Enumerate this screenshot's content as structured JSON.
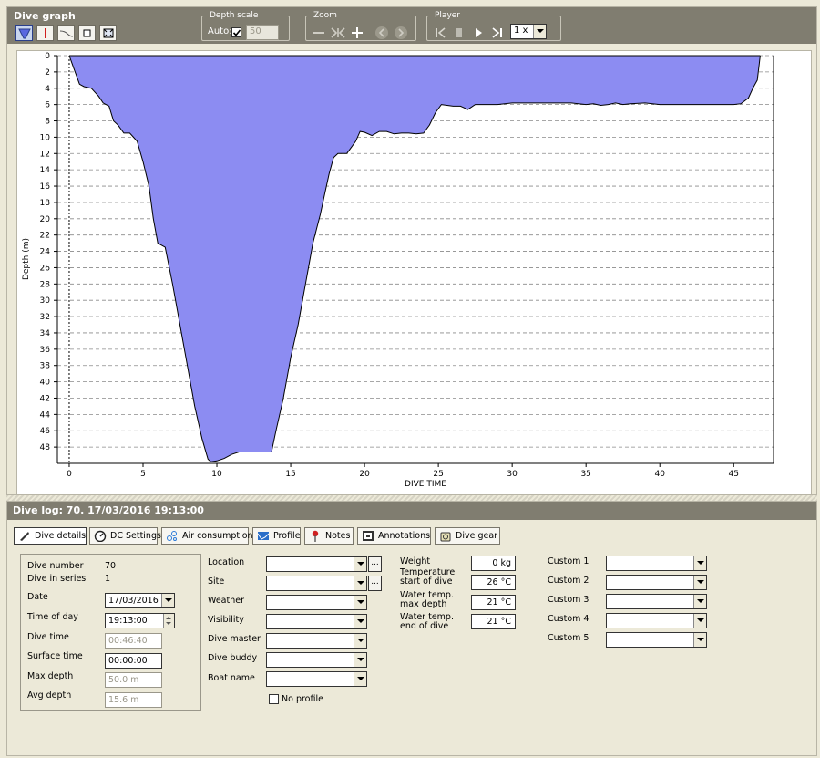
{
  "graph": {
    "title": "Dive graph",
    "groups": {
      "depth_scale": {
        "label": "Depth scale",
        "auto_label": "Auto:",
        "auto_checked": true,
        "value": "50"
      },
      "zoom": {
        "label": "Zoom"
      },
      "player": {
        "label": "Player",
        "speed": "1 x"
      }
    },
    "tools": [
      {
        "name": "profile-tool",
        "icon": "funnel-icon",
        "active": true
      },
      {
        "name": "marker-tool",
        "icon": "marker-icon",
        "active": false
      },
      {
        "name": "curve-tool",
        "icon": "curve-icon",
        "active": false
      },
      {
        "name": "single-view-tool",
        "icon": "square-icon",
        "active": false
      },
      {
        "name": "full-view-tool",
        "icon": "expand-icon",
        "active": false
      }
    ]
  },
  "chart_data": {
    "type": "area",
    "xlabel": "DIVE TIME",
    "ylabel": "Depth (m)",
    "xlim": [
      -0.8,
      47.7
    ],
    "ylim": [
      50,
      0
    ],
    "x_ticks": [
      0,
      5,
      10,
      15,
      20,
      25,
      30,
      35,
      40,
      45
    ],
    "y_ticks": [
      0,
      2,
      4,
      6,
      8,
      10,
      12,
      14,
      16,
      18,
      20,
      22,
      24,
      26,
      28,
      30,
      32,
      34,
      36,
      38,
      40,
      42,
      44,
      46,
      48
    ],
    "grid": "horizontal-dashed",
    "fill_color": "#8c8cf2",
    "line_color": "#000000",
    "series": [
      {
        "x": [
          0,
          0.3,
          0.7,
          1,
          1.5,
          2,
          2.3,
          2.7,
          3,
          3.3,
          3.7,
          4.1,
          4.3,
          4.6,
          5,
          5.4,
          5.7,
          6,
          6.5,
          7,
          7.5,
          8,
          8.5,
          9,
          9.4,
          9.6,
          10,
          10.5,
          11,
          11.5,
          13.7,
          14,
          14.5,
          15,
          15.5,
          16,
          16.5,
          17,
          17.3,
          17.6,
          17.9,
          18.2,
          18.8,
          19,
          19.4,
          19.7,
          20,
          20.5,
          21,
          21.5,
          22,
          22.5,
          23,
          23.5,
          24,
          24.4,
          24.8,
          25.2,
          26,
          26.5,
          27,
          27.5,
          28,
          29,
          30,
          31,
          32,
          33,
          34,
          35,
          35.5,
          36,
          36.5,
          37,
          37.5,
          38,
          39,
          40,
          41,
          42,
          43,
          44,
          45,
          45.5,
          46,
          46.3,
          46.6,
          46.8
        ],
        "y": [
          0,
          1.5,
          3.5,
          3.8,
          4,
          5,
          5.8,
          6.2,
          8,
          8.5,
          9.5,
          9.5,
          9.9,
          10.5,
          13,
          16,
          20,
          23,
          23.5,
          28,
          33,
          38,
          43,
          47,
          49.5,
          49.8,
          49.7,
          49.4,
          48.9,
          48.6,
          48.6,
          46,
          42,
          37,
          33,
          28,
          23,
          19.5,
          17,
          14.5,
          12.5,
          12,
          12,
          11.5,
          10.5,
          9.3,
          9.4,
          9.8,
          9.3,
          9.3,
          9.6,
          9.5,
          9.5,
          9.6,
          9.5,
          8.5,
          7,
          6,
          6.2,
          6.2,
          6.6,
          6,
          6,
          6,
          5.8,
          5.8,
          5.8,
          5.8,
          5.8,
          6,
          5.9,
          6.1,
          6,
          5.8,
          6,
          5.9,
          5.8,
          6,
          6,
          6,
          6,
          6,
          6,
          5.9,
          5.2,
          4,
          3,
          0
        ]
      }
    ]
  },
  "log": {
    "title": "Dive log: 70. 17/03/2016 19:13:00",
    "tabs": [
      {
        "label": "Dive details",
        "icon": "fins-icon"
      },
      {
        "label": "DC Settings",
        "icon": "gauge-icon"
      },
      {
        "label": "Air consumption",
        "icon": "bubbles-icon"
      },
      {
        "label": "Profile",
        "icon": "profile-icon"
      },
      {
        "label": "Notes",
        "icon": "pin-icon"
      },
      {
        "label": "Annotations",
        "icon": "film-icon"
      },
      {
        "label": "Dive gear",
        "icon": "gear-bag-icon"
      }
    ],
    "details": {
      "dive_number_label": "Dive number",
      "dive_number": "70",
      "dive_in_series_label": "Dive in series",
      "dive_in_series": "1",
      "date_label": "Date",
      "date": "17/03/2016",
      "time_of_day_label": "Time of day",
      "time_of_day": "19:13:00",
      "dive_time_label": "Dive time",
      "dive_time": "00:46:40",
      "surface_time_label": "Surface time",
      "surface_time": "00:00:00",
      "max_depth_label": "Max depth",
      "max_depth": "50.0 m",
      "avg_depth_label": "Avg depth",
      "avg_depth": "15.6 m"
    },
    "site_fields": [
      {
        "label": "Location",
        "value": "",
        "has_browse": true
      },
      {
        "label": "Site",
        "value": "",
        "has_browse": true
      },
      {
        "label": "Weather",
        "value": "",
        "has_browse": false
      },
      {
        "label": "Visibility",
        "value": "",
        "has_browse": false
      },
      {
        "label": "Dive master",
        "value": "",
        "has_browse": false
      },
      {
        "label": "Dive buddy",
        "value": "",
        "has_browse": false
      },
      {
        "label": "Boat name",
        "value": "",
        "has_browse": false
      }
    ],
    "browse_label": "...",
    "no_profile_label": "No profile",
    "no_profile_checked": false,
    "measurements": [
      {
        "label1": "Weight",
        "label2": "",
        "value": "0 kg"
      },
      {
        "label1": "Temperature",
        "label2": "start of dive",
        "value": "26 °C"
      },
      {
        "label1": "Water temp.",
        "label2": "max depth",
        "value": "21 °C"
      },
      {
        "label1": "Water temp.",
        "label2": "end of dive",
        "value": "21 °C"
      }
    ],
    "custom_fields": [
      {
        "label": "Custom 1",
        "value": ""
      },
      {
        "label": "Custom 2",
        "value": ""
      },
      {
        "label": "Custom 3",
        "value": ""
      },
      {
        "label": "Custom 4",
        "value": ""
      },
      {
        "label": "Custom 5",
        "value": ""
      }
    ]
  }
}
